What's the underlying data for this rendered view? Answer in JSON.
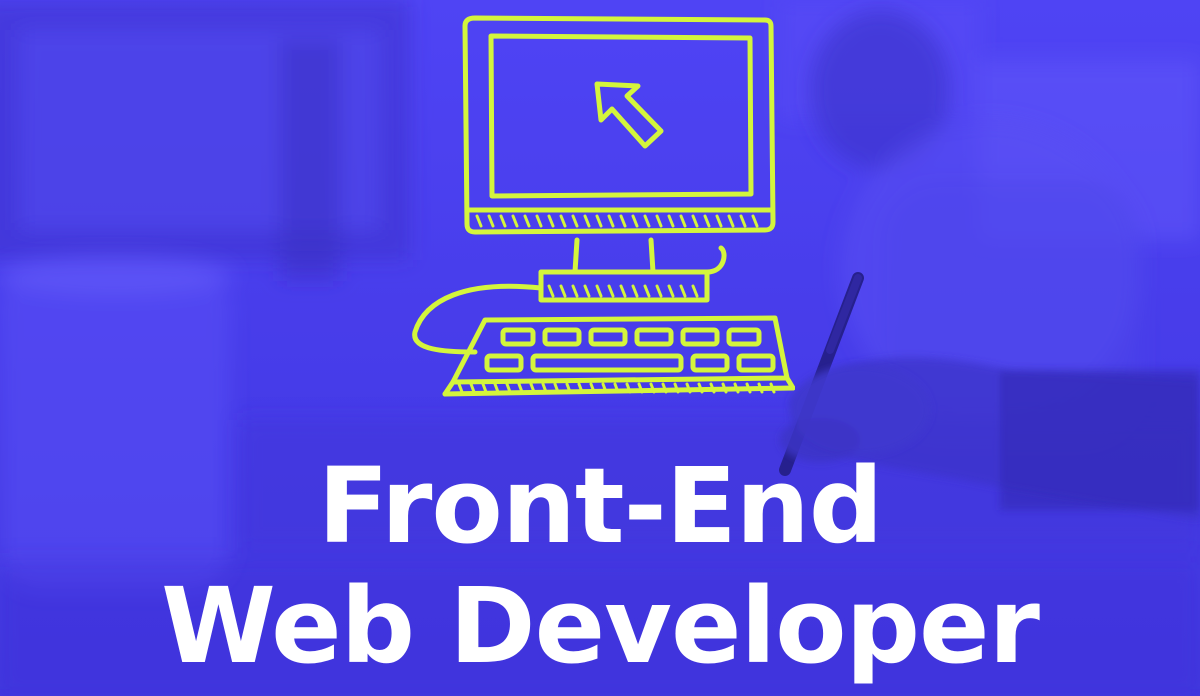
{
  "banner": {
    "title_line_1": "Front-End",
    "title_line_2": "Web Developer",
    "colors": {
      "background": "#4a3ff0",
      "accent": "#d4f53c",
      "text": "#ffffff"
    },
    "icons": [
      "computer-illustration",
      "cursor-arrow-icon",
      "keyboard-icon"
    ]
  }
}
